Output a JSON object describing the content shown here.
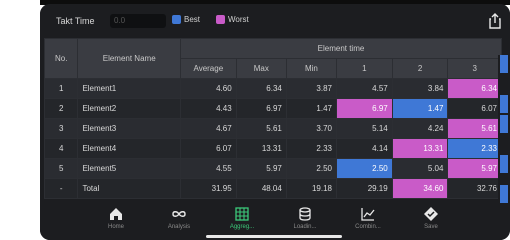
{
  "header": {
    "takt_label": "Takt Time",
    "takt_value": "0.0",
    "best_label": "Best",
    "worst_label": "Worst",
    "best_color": "#3f78d6",
    "worst_color": "#c95bc8"
  },
  "table": {
    "col_no": "No.",
    "col_name": "Element Name",
    "group_header": "Element time",
    "subheaders": [
      "Average",
      "Max",
      "Min",
      "1",
      "2",
      "3"
    ],
    "rows": [
      {
        "no": "1",
        "name": "Element1",
        "avg": "4.60",
        "max": "6.34",
        "min": "3.87",
        "t1": "4.57",
        "t2": "3.84",
        "t3": "6.34"
      },
      {
        "no": "2",
        "name": "Element2",
        "avg": "4.43",
        "max": "6.97",
        "min": "1.47",
        "t1": "6.97",
        "t2": "1.47",
        "t3": "6.07"
      },
      {
        "no": "3",
        "name": "Element3",
        "avg": "4.67",
        "max": "5.61",
        "min": "3.70",
        "t1": "5.14",
        "t2": "4.24",
        "t3": "5.61"
      },
      {
        "no": "4",
        "name": "Element4",
        "avg": "6.07",
        "max": "13.31",
        "min": "2.33",
        "t1": "4.14",
        "t2": "13.31",
        "t3": "2.33"
      },
      {
        "no": "5",
        "name": "Element5",
        "avg": "4.55",
        "max": "5.97",
        "min": "2.50",
        "t1": "2.50",
        "t2": "5.04",
        "t3": "5.97"
      }
    ],
    "total": {
      "no": "-",
      "name": "Total",
      "avg": "31.95",
      "max": "48.04",
      "min": "19.18",
      "t1": "29.19",
      "t2": "34.60",
      "t3": "32.76"
    }
  },
  "tabs": [
    {
      "label": "Home",
      "icon": "home-icon"
    },
    {
      "label": "Analysis",
      "icon": "infinity-icon"
    },
    {
      "label": "Aggreg...",
      "icon": "table-grid-icon",
      "active": true
    },
    {
      "label": "Loadin...",
      "icon": "database-icon"
    },
    {
      "label": "Combin...",
      "icon": "line-chart-icon"
    },
    {
      "label": "Save",
      "icon": "diamond-check-icon"
    }
  ]
}
